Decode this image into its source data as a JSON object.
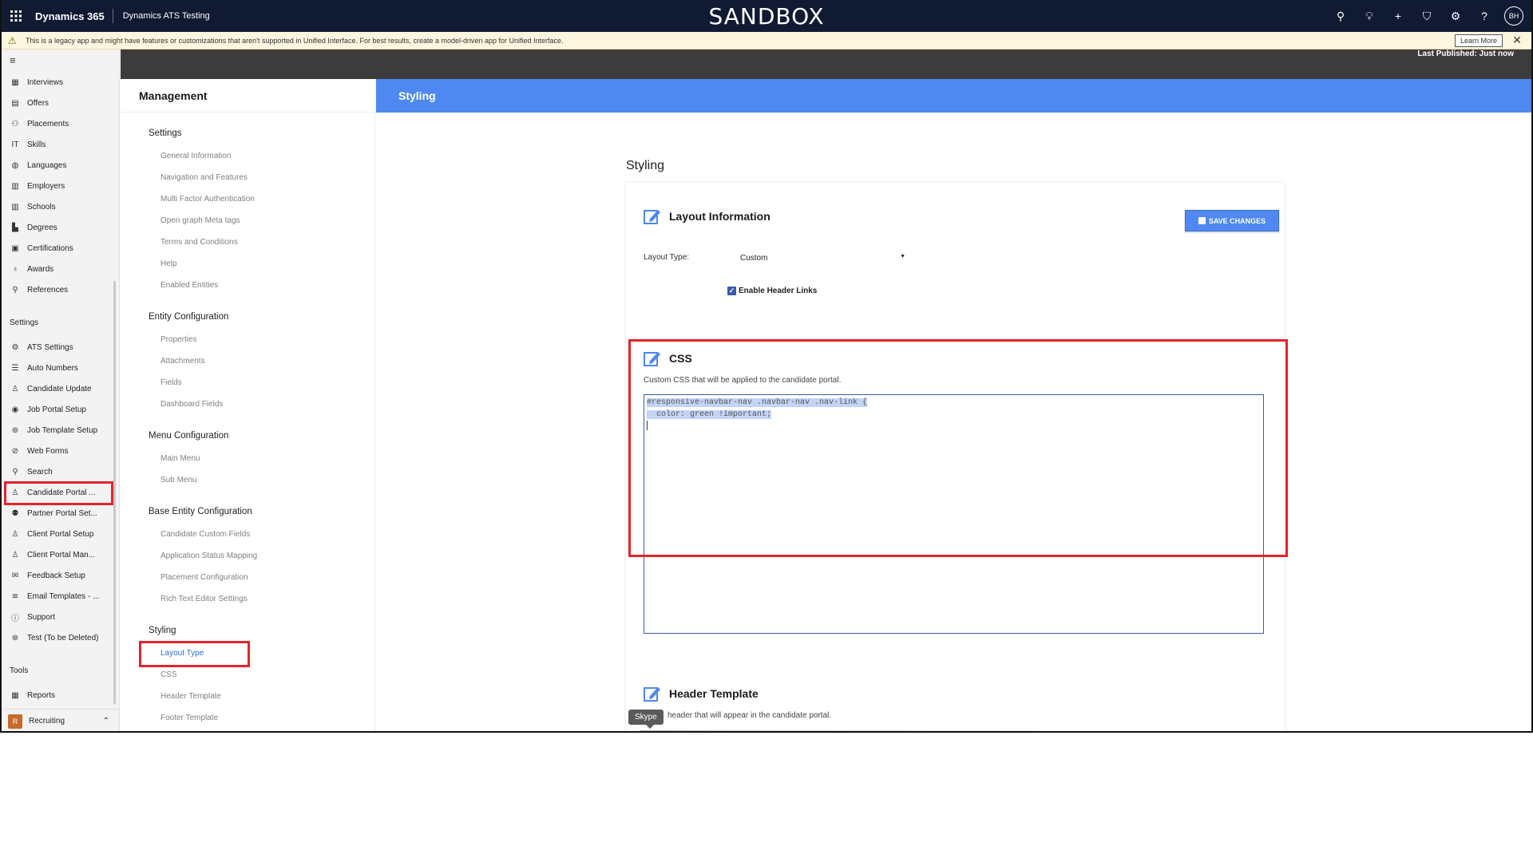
{
  "topbar": {
    "brand": "Dynamics 365",
    "app_name": "Dynamics ATS Testing",
    "environment": "SANDBOX",
    "avatar": "BH",
    "icons": [
      "search-icon",
      "lightbulb-icon",
      "plus-icon",
      "filter-icon",
      "gear-icon",
      "help-icon"
    ]
  },
  "notice": {
    "text": "This is a legacy app and might have features or customizations that aren't supported in Unified Interface. For best results, create a model-driven app for Unified Interface.",
    "learn_more": "Learn More"
  },
  "sidebar": {
    "items": [
      {
        "label": "Interviews",
        "icon": "calendar-icon"
      },
      {
        "label": "Offers",
        "icon": "document-icon"
      },
      {
        "label": "Placements",
        "icon": "people-icon"
      },
      {
        "label": "Skills",
        "icon": "skills-icon"
      },
      {
        "label": "Languages",
        "icon": "globe-icon"
      },
      {
        "label": "Employers",
        "icon": "building-icon"
      },
      {
        "label": "Schools",
        "icon": "school-icon"
      },
      {
        "label": "Degrees",
        "icon": "book-icon"
      },
      {
        "label": "Certifications",
        "icon": "certificate-icon"
      },
      {
        "label": "Awards",
        "icon": "award-icon"
      },
      {
        "label": "References",
        "icon": "contact-icon"
      }
    ],
    "settings_header": "Settings",
    "settings_items": [
      {
        "label": "ATS Settings",
        "icon": "gear-icon"
      },
      {
        "label": "Auto Numbers",
        "icon": "list-icon"
      },
      {
        "label": "Candidate Update",
        "icon": "person-icon"
      },
      {
        "label": "Job Portal Setup",
        "icon": "portal-icon"
      },
      {
        "label": "Job Template Setup",
        "icon": "template-icon"
      },
      {
        "label": "Web Forms",
        "icon": "form-icon"
      },
      {
        "label": "Search",
        "icon": "search-person-icon"
      },
      {
        "label": "Candidate Portal ...",
        "icon": "person-icon"
      },
      {
        "label": "Partner Portal Set...",
        "icon": "partner-icon"
      },
      {
        "label": "Client Portal Setup",
        "icon": "person-icon"
      },
      {
        "label": "Client Portal Man...",
        "icon": "person-icon"
      },
      {
        "label": "Feedback Setup",
        "icon": "feedback-icon"
      },
      {
        "label": "Email Templates - ...",
        "icon": "stack-icon"
      },
      {
        "label": "Support",
        "icon": "help-icon"
      },
      {
        "label": "Test (To be Deleted)",
        "icon": "test-icon"
      }
    ],
    "tools_header": "Tools",
    "tools_items": [
      {
        "label": "Reports",
        "icon": "report-icon"
      }
    ],
    "area": {
      "badge": "R",
      "label": "Recruiting"
    }
  },
  "header_strip": {
    "last_published": "Last Published: Just now"
  },
  "management": {
    "title": "Management",
    "sections": [
      {
        "title": "Settings",
        "links": [
          "General Information",
          "Navigation and Features",
          "Multi Factor Authentication",
          "Open graph Meta tags",
          "Terms and Conditions",
          "Help",
          "Enabled Entities"
        ]
      },
      {
        "title": "Entity Configuration",
        "links": [
          "Properties",
          "Attachments",
          "Fields",
          "Dashboard Fields"
        ]
      },
      {
        "title": "Menu Configuration",
        "links": [
          "Main Menu",
          "Sub Menu"
        ]
      },
      {
        "title": "Base Entity Configuration",
        "links": [
          "Candidate Custom Fields",
          "Application Status Mapping",
          "Placement Configuration",
          "Rich Text Editor Settings"
        ]
      },
      {
        "title": "Styling",
        "links": [
          "Layout Type",
          "CSS",
          "Header Template",
          "Footer Template"
        ]
      }
    ],
    "active_link": "Layout Type"
  },
  "main": {
    "header": "Styling",
    "page_title": "Styling",
    "layout_info": {
      "title": "Layout Information",
      "save_label": "SAVE CHANGES",
      "layout_type_label": "Layout Type:",
      "layout_type_value": "Custom",
      "enable_header_links": "Enable Header Links",
      "enable_header_links_checked": true
    },
    "css": {
      "title": "CSS",
      "description": "Custom CSS that will be applied to the candidate portal.",
      "code_lines": [
        "#responsive-navbar-nav .navbar-nav .nav-link {",
        "  color: green !important;",
        ""
      ]
    },
    "header_template": {
      "title": "Header Template",
      "description": "header that will appear in the candidate portal."
    },
    "tooltip": "Skype"
  },
  "colors": {
    "topbar": "#101a33",
    "accent": "#4f88f0",
    "highlight_box": "#e3242b"
  }
}
